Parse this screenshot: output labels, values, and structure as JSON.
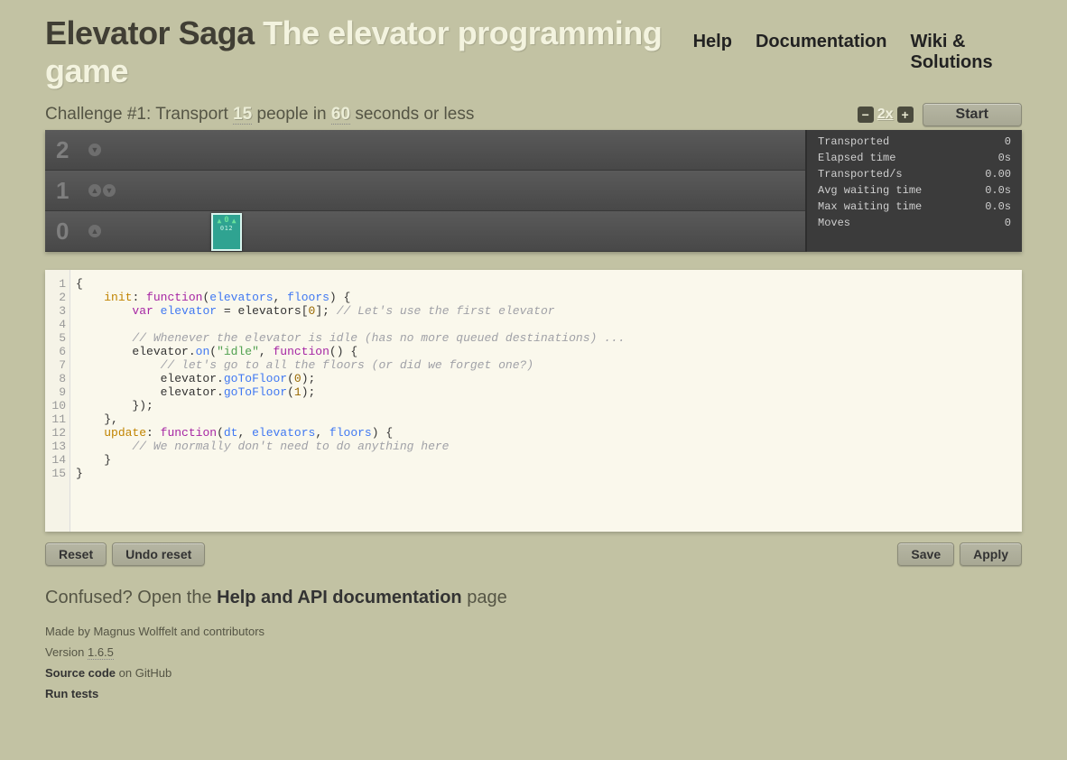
{
  "header": {
    "title_main": "Elevator Saga",
    "title_sub": "The elevator programming game",
    "nav": {
      "help": "Help",
      "docs": "Documentation",
      "wiki": "Wiki & Solutions"
    }
  },
  "challenge": {
    "prefix": "Challenge #1: Transport ",
    "people": "15",
    "mid": " people in ",
    "seconds": "60",
    "suffix": " seconds or less"
  },
  "controls": {
    "minus": "−",
    "speed": "2x",
    "plus": "+",
    "start": "Start"
  },
  "floors": [
    {
      "num": "2",
      "up": false,
      "down": true
    },
    {
      "num": "1",
      "up": true,
      "down": true
    },
    {
      "num": "0",
      "up": true,
      "down": false
    }
  ],
  "elevator": {
    "floor_display": "0",
    "label": "012"
  },
  "stats": [
    {
      "label": "Transported",
      "value": "0"
    },
    {
      "label": "Elapsed time",
      "value": "0s"
    },
    {
      "label": "Transported/s",
      "value": "0.00"
    },
    {
      "label": "Avg waiting time",
      "value": "0.0s"
    },
    {
      "label": "Max waiting time",
      "value": "0.0s"
    },
    {
      "label": "Moves",
      "value": "0"
    }
  ],
  "code_lines": 15,
  "code_tokens": [
    [
      [
        "punct",
        "{"
      ]
    ],
    [
      [
        "plain",
        "    "
      ],
      [
        "atom",
        "init"
      ],
      [
        "punct",
        ": "
      ],
      [
        "keyword",
        "function"
      ],
      [
        "punct",
        "("
      ],
      [
        "def",
        "elevators"
      ],
      [
        "punct",
        ", "
      ],
      [
        "def",
        "floors"
      ],
      [
        "punct",
        ") {"
      ]
    ],
    [
      [
        "plain",
        "        "
      ],
      [
        "keyword",
        "var"
      ],
      [
        "plain",
        " "
      ],
      [
        "def",
        "elevator"
      ],
      [
        "plain",
        " = "
      ],
      [
        "var",
        "elevators"
      ],
      [
        "punct",
        "["
      ],
      [
        "number",
        "0"
      ],
      [
        "punct",
        "]; "
      ],
      [
        "comment",
        "// Let's use the first elevator"
      ]
    ],
    [],
    [
      [
        "plain",
        "        "
      ],
      [
        "comment",
        "// Whenever the elevator is idle (has no more queued destinations) ..."
      ]
    ],
    [
      [
        "plain",
        "        "
      ],
      [
        "var",
        "elevator"
      ],
      [
        "punct",
        "."
      ],
      [
        "method",
        "on"
      ],
      [
        "punct",
        "("
      ],
      [
        "string",
        "\"idle\""
      ],
      [
        "punct",
        ", "
      ],
      [
        "keyword",
        "function"
      ],
      [
        "punct",
        "() {"
      ]
    ],
    [
      [
        "plain",
        "            "
      ],
      [
        "comment",
        "// let's go to all the floors (or did we forget one?)"
      ]
    ],
    [
      [
        "plain",
        "            "
      ],
      [
        "var",
        "elevator"
      ],
      [
        "punct",
        "."
      ],
      [
        "method",
        "goToFloor"
      ],
      [
        "punct",
        "("
      ],
      [
        "number",
        "0"
      ],
      [
        "punct",
        ");"
      ]
    ],
    [
      [
        "plain",
        "            "
      ],
      [
        "var",
        "elevator"
      ],
      [
        "punct",
        "."
      ],
      [
        "method",
        "goToFloor"
      ],
      [
        "punct",
        "("
      ],
      [
        "number",
        "1"
      ],
      [
        "punct",
        ");"
      ]
    ],
    [
      [
        "plain",
        "        });"
      ]
    ],
    [
      [
        "plain",
        "    },"
      ]
    ],
    [
      [
        "plain",
        "    "
      ],
      [
        "atom",
        "update"
      ],
      [
        "punct",
        ": "
      ],
      [
        "keyword",
        "function"
      ],
      [
        "punct",
        "("
      ],
      [
        "def",
        "dt"
      ],
      [
        "punct",
        ", "
      ],
      [
        "def",
        "elevators"
      ],
      [
        "punct",
        ", "
      ],
      [
        "def",
        "floors"
      ],
      [
        "punct",
        ") {"
      ]
    ],
    [
      [
        "plain",
        "        "
      ],
      [
        "comment",
        "// We normally don't need to do anything here"
      ]
    ],
    [
      [
        "plain",
        "    }"
      ]
    ],
    [
      [
        "punct",
        "}"
      ]
    ]
  ],
  "buttons": {
    "reset": "Reset",
    "undo": "Undo reset",
    "save": "Save",
    "apply": "Apply"
  },
  "footer": {
    "help_pre": "Confused? Open the ",
    "help_link": "Help and API documentation",
    "help_post": " page",
    "made_by": "Made by Magnus Wolffelt and contributors",
    "version_label": "Version ",
    "version": "1.6.5",
    "source_strong": "Source code",
    "source_rest": " on GitHub",
    "run_tests": "Run tests"
  }
}
